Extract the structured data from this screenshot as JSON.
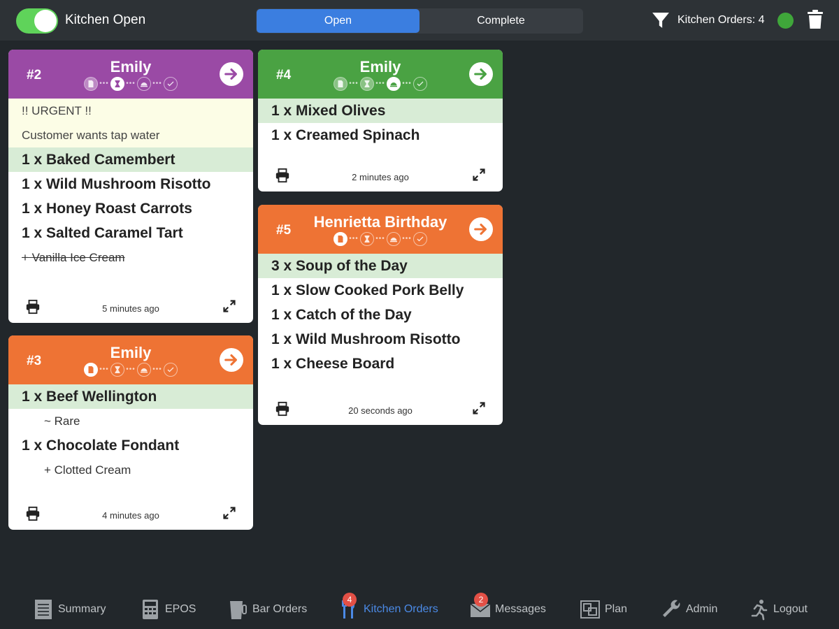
{
  "header": {
    "kitchen_toggle": {
      "label": "Kitchen Open",
      "on": true
    },
    "tabs": [
      {
        "label": "Open",
        "active": true
      },
      {
        "label": "Complete",
        "active": false
      }
    ],
    "orders_count_label": "Kitchen Orders: 4",
    "status_color": "#3fa63a"
  },
  "colors": {
    "purple": "#9a4aa5",
    "green": "#4aa243",
    "orange": "#ee7334",
    "highlight": "#d8ecd6",
    "note_bg": "#fcfde6",
    "active_tab": "#3b7ee0",
    "badge": "#e35046"
  },
  "orders": [
    {
      "number": "#2",
      "name": "Emily",
      "color": "purple",
      "progress_step": 2,
      "notes": [
        "!! URGENT !!",
        "Customer wants tap water"
      ],
      "lines": [
        {
          "kind": "item",
          "text": "1 x Baked Camembert",
          "highlight": true
        },
        {
          "kind": "item",
          "text": "1 x Wild Mushroom Risotto"
        },
        {
          "kind": "item",
          "text": "1 x Honey Roast Carrots"
        },
        {
          "kind": "item",
          "text": "1 x Salted Caramel Tart"
        },
        {
          "kind": "modifier",
          "text": "+ Vanilla Ice Cream",
          "struck": true
        }
      ],
      "time": "5 minutes ago"
    },
    {
      "number": "#3",
      "name": "Emily",
      "color": "orange",
      "progress_step": 1,
      "notes": [],
      "lines": [
        {
          "kind": "item",
          "text": "1 x Beef Wellington",
          "highlight": true
        },
        {
          "kind": "modifier",
          "text": "~ Rare"
        },
        {
          "kind": "item",
          "text": "1 x Chocolate Fondant"
        },
        {
          "kind": "modifier",
          "text": "+ Clotted Cream"
        }
      ],
      "time": "4 minutes ago"
    },
    {
      "number": "#4",
      "name": "Emily",
      "color": "green",
      "progress_step": 3,
      "notes": [],
      "lines": [
        {
          "kind": "item",
          "text": "1 x Mixed Olives",
          "highlight": true
        },
        {
          "kind": "item",
          "text": "1 x Creamed Spinach"
        }
      ],
      "time": "2 minutes ago"
    },
    {
      "number": "#5",
      "name": "Henrietta Birthday",
      "color": "orange",
      "progress_step": 1,
      "notes": [],
      "lines": [
        {
          "kind": "item",
          "text": "3 x Soup of the Day",
          "highlight": true
        },
        {
          "kind": "item",
          "text": "1 x Slow Cooked Pork Belly"
        },
        {
          "kind": "item",
          "text": "1 x Catch of the Day"
        },
        {
          "kind": "item",
          "text": "1 x Wild Mushroom Risotto"
        },
        {
          "kind": "item",
          "text": "1 x Cheese Board"
        }
      ],
      "time": "20 seconds ago"
    }
  ],
  "progress_icons": [
    "document-icon",
    "hourglass-icon",
    "cloche-icon",
    "check-icon"
  ],
  "nav": [
    {
      "label": "Summary",
      "icon": "notepad-icon"
    },
    {
      "label": "EPOS",
      "icon": "calculator-icon"
    },
    {
      "label": "Bar Orders",
      "icon": "beer-glass-icon"
    },
    {
      "label": "Kitchen Orders",
      "icon": "fork-knife-icon",
      "badge": "4",
      "active": true
    },
    {
      "label": "Messages",
      "icon": "envelope-icon",
      "badge": "2"
    },
    {
      "label": "Plan",
      "icon": "floor-plan-icon"
    },
    {
      "label": "Admin",
      "icon": "wrench-icon"
    },
    {
      "label": "Logout",
      "icon": "running-man-icon"
    }
  ]
}
